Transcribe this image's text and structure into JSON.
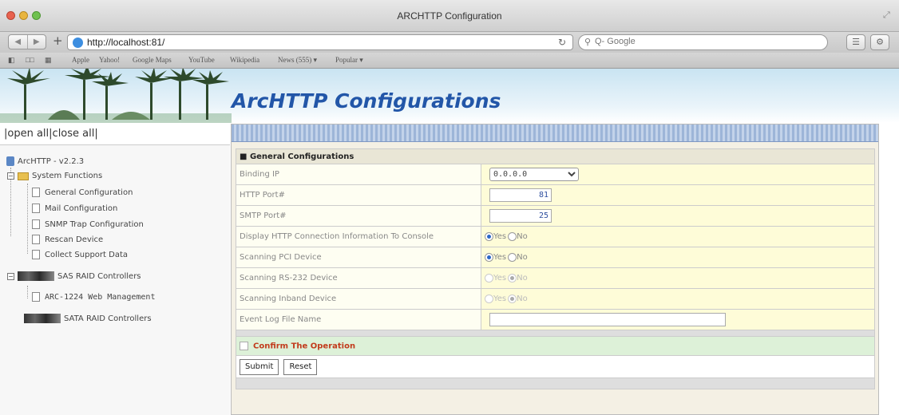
{
  "window": {
    "title": "ARCHTTP Configuration"
  },
  "browser": {
    "url": "http://localhost:81/",
    "search_placeholder": "Q- Google",
    "bookmarks": [
      "Apple",
      "Yahoo!",
      "Google Maps",
      "YouTube",
      "Wikipedia",
      "News (555) ▾",
      "Popular ▾"
    ]
  },
  "banner": {
    "title": "ArcHTTP Configurations"
  },
  "nav": {
    "open_all": "open all",
    "close_all": "close all",
    "root": "ArcHTTP - v2.2.3",
    "system_functions": "System Functions",
    "system_items": [
      "General Configuration",
      "Mail Configuration",
      "SNMP Trap Configuration",
      "Rescan Device",
      "Collect Support Data"
    ],
    "sas_group": "SAS RAID Controllers",
    "sas_item": "ARC-1224 Web Management",
    "sata_group": "SATA RAID Controllers"
  },
  "form": {
    "section_title": "General Configurations",
    "rows": {
      "binding_ip": {
        "label": "Binding IP",
        "value": "0.0.0.0"
      },
      "http_port": {
        "label": "HTTP Port#",
        "value": "81"
      },
      "smtp_port": {
        "label": "SMTP Port#",
        "value": "25"
      },
      "display_http": {
        "label": "Display HTTP Connection Information To Console",
        "selected": "Yes"
      },
      "scan_pci": {
        "label": "Scanning PCI Device",
        "selected": "Yes"
      },
      "scan_rs232": {
        "label": "Scanning RS-232 Device",
        "selected": "No"
      },
      "scan_inband": {
        "label": "Scanning Inband Device",
        "selected": "No"
      },
      "event_log": {
        "label": "Event Log File Name",
        "value": ""
      }
    },
    "yes_label": "Yes",
    "no_label": "No",
    "confirm_label": "Confirm The Operation",
    "submit_label": "Submit",
    "reset_label": "Reset"
  }
}
